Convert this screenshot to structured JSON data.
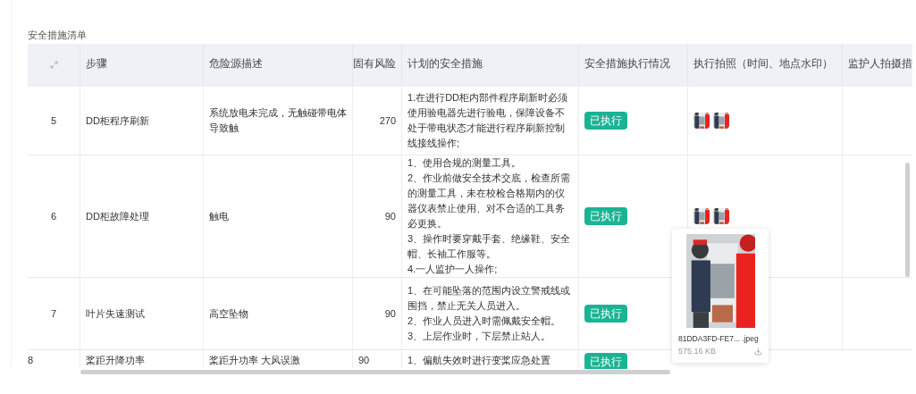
{
  "section_title": "安全措施清单",
  "table": {
    "columns": [
      "步骤",
      "危险源描述",
      "固有风险",
      "计划的安全措施",
      "安全措施执行情况",
      "执行拍照（时间、地点水印）",
      "监护人拍摄措"
    ],
    "rows": [
      {
        "index": "5",
        "step": "DD柜程序刷新",
        "hazard": "系统放电未完成，无触碰带电体导致触",
        "risk": "270",
        "measures": [
          "1.在进行DD柜内部件程序刷新时必须使用验电器先进行验电，保障设备不处于带电状态才能进行程序刷新控制线接线操作;"
        ],
        "status": {
          "label": "已执行",
          "kind": "done"
        },
        "photos": [
          {
            "kind": "picture"
          },
          {
            "kind": "picture"
          }
        ]
      },
      {
        "index": "6",
        "step": "DD柜故障处理",
        "hazard": "触电",
        "risk": "90",
        "measures": [
          "1、使用合规的测量工具。",
          "2、作业前做安全技术交底，检查所需的测量工具，未在校检合格期内的仪器仪表禁止使用、对不合适的工具务必更换。",
          "3、操作时要穿戴手套、绝缘鞋、安全帽、长袖工作服等。",
          "4.一人监护一人操作;"
        ],
        "status": {
          "label": "已执行",
          "kind": "done"
        },
        "photos": [
          {
            "kind": "picture"
          },
          {
            "kind": "picture"
          }
        ]
      },
      {
        "index": "7",
        "step": "叶片失速测试",
        "hazard": "高空坠物",
        "risk": "90",
        "measures": [
          "1、在可能坠落的范围内设立警戒线或围挡，禁止无关人员进入。",
          "2、作业人员进入时需佩戴安全帽。",
          "3、上层作业时，下层禁止站人。"
        ],
        "status": {
          "label": "已执行",
          "kind": "done"
        },
        "photos": []
      },
      {
        "index": "8",
        "step": "桨距升降功率",
        "hazard": "桨距升功率 大风误激",
        "risk": "90",
        "measures": [
          "1、偏航失效时进行变桨应急处置"
        ],
        "status": {
          "label": "已执行",
          "kind": "done"
        },
        "photos": []
      }
    ]
  },
  "preview": {
    "kind": "picture",
    "filename": "81DDA3FD-FE7... .jpeg",
    "size": "575.16 KB"
  }
}
